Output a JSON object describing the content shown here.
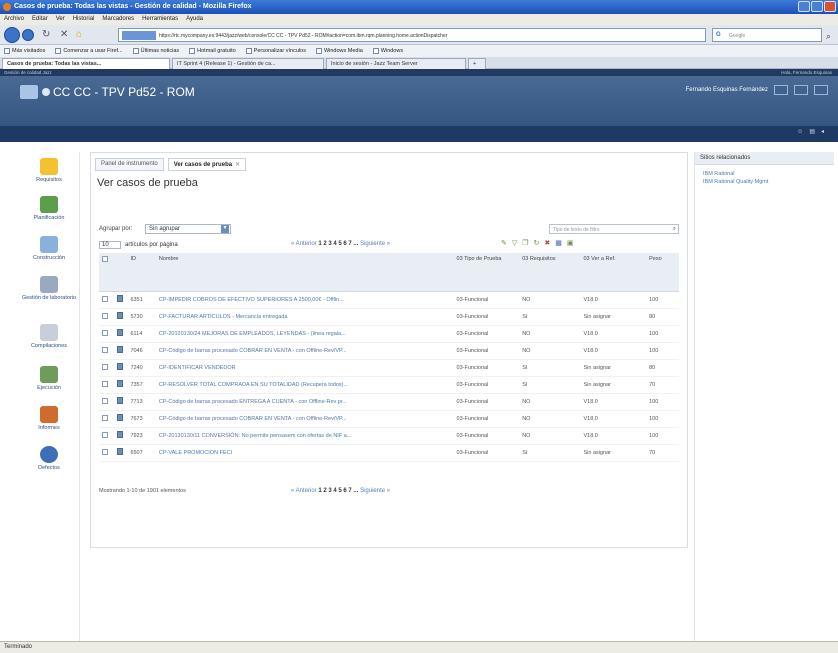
{
  "window": {
    "title": "Casos de prueba: Todas las vistas - Gestión de calidad - Mozilla Firefox"
  },
  "menu": [
    "Archivo",
    "Editar",
    "Ver",
    "Historial",
    "Marcadores",
    "Herramientas",
    "Ayuda"
  ],
  "nav": {
    "url": "https://rtc.mycompany.es:9443/jazz/web/console/CC CC - TPV Pd52 - ROM#action=com.ibm.rqm.planning.home.actionDispatcher",
    "search_placeholder": "Google",
    "back_icon": "back-arrow-icon",
    "forward_icon": "forward-arrow-icon",
    "reload_icon": "reload-icon",
    "stop_icon": "stop-icon",
    "home_icon": "home-icon"
  },
  "bookmarks": [
    "Más visitados",
    "Comenzar a usar Firef...",
    "Últimas noticias",
    "Hotmail gratuito",
    "Personalizar vínculos",
    "Windows Media",
    "Windows"
  ],
  "browser_tabs": [
    {
      "label": "Casos de prueba: Todas las vistas...",
      "active": true
    },
    {
      "label": "IT Sprint 4 (Release 1) - Gestión de ca...",
      "active": false
    },
    {
      "label": "Inicio de sesión - Jazz Team Server",
      "active": false
    }
  ],
  "app": {
    "project": "CC CC - TPV Pd52 - ROM",
    "user": "Fernando Esquinas Fernández",
    "topstrip_left": "Gestión de calidad Jazz",
    "topstrip_right": "Hola, Fernando Esquinas"
  },
  "sidebar": [
    {
      "key": "requisitos",
      "label": "Requisitos",
      "icon": "requirements-icon",
      "color": "#f2c230"
    },
    {
      "key": "planificacion",
      "label": "Planificación",
      "icon": "planning-icon",
      "color": "#5d9e4a"
    },
    {
      "key": "construccion",
      "label": "Construcción",
      "icon": "construction-icon",
      "color": "#8ab1d9"
    },
    {
      "key": "gestion",
      "label": "Gestión de laboratorio",
      "icon": "lab-management-icon",
      "color": "#9aa9bf"
    },
    {
      "key": "compilaciones",
      "label": "Compilaciones",
      "icon": "builds-icon",
      "color": "#c9cfd8"
    },
    {
      "key": "ejecucion",
      "label": "Ejecución",
      "icon": "execution-icon",
      "color": "#6e9c5a"
    },
    {
      "key": "informes",
      "label": "Informes",
      "icon": "reports-icon",
      "color": "#d06b2e"
    },
    {
      "key": "defectos",
      "label": "Defectos",
      "icon": "defects-icon",
      "color": "#3d6fb8"
    }
  ],
  "content_tabs": [
    {
      "label": "Panel de instrumento",
      "active": false
    },
    {
      "label": "Ver casos de prueba",
      "active": true
    }
  ],
  "page_title": "Ver casos de prueba",
  "group_by": {
    "label": "Agrupar por:",
    "value": "Sin agrupar"
  },
  "table_search_placeholder": "Tipo de texto de filtro",
  "per_page": {
    "value": "10",
    "label": "artículos por página"
  },
  "pager": {
    "prefix": "« Anterior",
    "pages": "1 2 3 4 5 6 7 ...",
    "next": "Siguiente »"
  },
  "table": {
    "headers": [
      "",
      "",
      "ID",
      "Nombre",
      "03 Tipo de Prueba",
      "03 Requisitos",
      "03 Ver a Ref.",
      "Peso"
    ],
    "rows": [
      {
        "id": "6351",
        "name": "CP-IMPEDIR COBROS DE EFECTIVO SUPERIORES A 2500,00€ - Offlin...",
        "tipo": "03-Funcional",
        "req": "NO",
        "ver": "V18.0",
        "peso": "100"
      },
      {
        "id": "5730",
        "name": "CP-FACTURAR ARTÍCULOS - Mercancía entregada",
        "tipo": "03-Funcional",
        "req": "SI",
        "ver": "Sin asignar",
        "peso": "80"
      },
      {
        "id": "6114",
        "name": "CP-20120130/24 MEJORAS DE EMPLEADOS, LEYENDAS - (linea regala...",
        "tipo": "03-Funcional",
        "req": "NO",
        "ver": "V18.0",
        "peso": "100"
      },
      {
        "id": "7046",
        "name": "CP-Código de barras procesado COBRAR EN VENTA - con Offline-Rev/VP...",
        "tipo": "03-Funcional",
        "req": "NO",
        "ver": "V18.0",
        "peso": "100"
      },
      {
        "id": "7240",
        "name": "CP-IDENTIFICAR VENDEDOR",
        "tipo": "03-Funcional",
        "req": "SI",
        "ver": "Sin asignar",
        "peso": "80"
      },
      {
        "id": "7357",
        "name": "CP-RESOLVER TOTAL COMPRADA EN SU TOTALIDAD (Recupera todos)...",
        "tipo": "03-Funcional",
        "req": "SI",
        "ver": "Sin asignar",
        "peso": "70"
      },
      {
        "id": "7713",
        "name": "CP-Código de barras procesado ENTREGA A CUENTA - con Offline-Rev pr...",
        "tipo": "03-Funcional",
        "req": "NO",
        "ver": "V18.0",
        "peso": "100"
      },
      {
        "id": "7673",
        "name": "CP-Código de barras procesado COBRAR EN VENTA - con Offline-Rev/VP...",
        "tipo": "03-Funcional",
        "req": "NO",
        "ver": "V18.0",
        "peso": "100"
      },
      {
        "id": "7923",
        "name": "CP-20130130/11 CONVERSIÓN: No permite pensasem con ofertas de NIF a...",
        "tipo": "03-Funcional",
        "req": "NO",
        "ver": "V18.0",
        "peso": "100"
      },
      {
        "id": "6507",
        "name": "CP-VALE PROMOCION FECI",
        "tipo": "03-Funcional",
        "req": "SI",
        "ver": "Sin asignar",
        "peso": "70"
      }
    ]
  },
  "footer_count": "Mostrando 1-10 de 1901 elementos",
  "right_panel": {
    "header": "Sitios relacionados",
    "links": [
      "IBM Rational",
      "IBM Rational Quality Mgmt"
    ]
  },
  "status": "Terminado"
}
